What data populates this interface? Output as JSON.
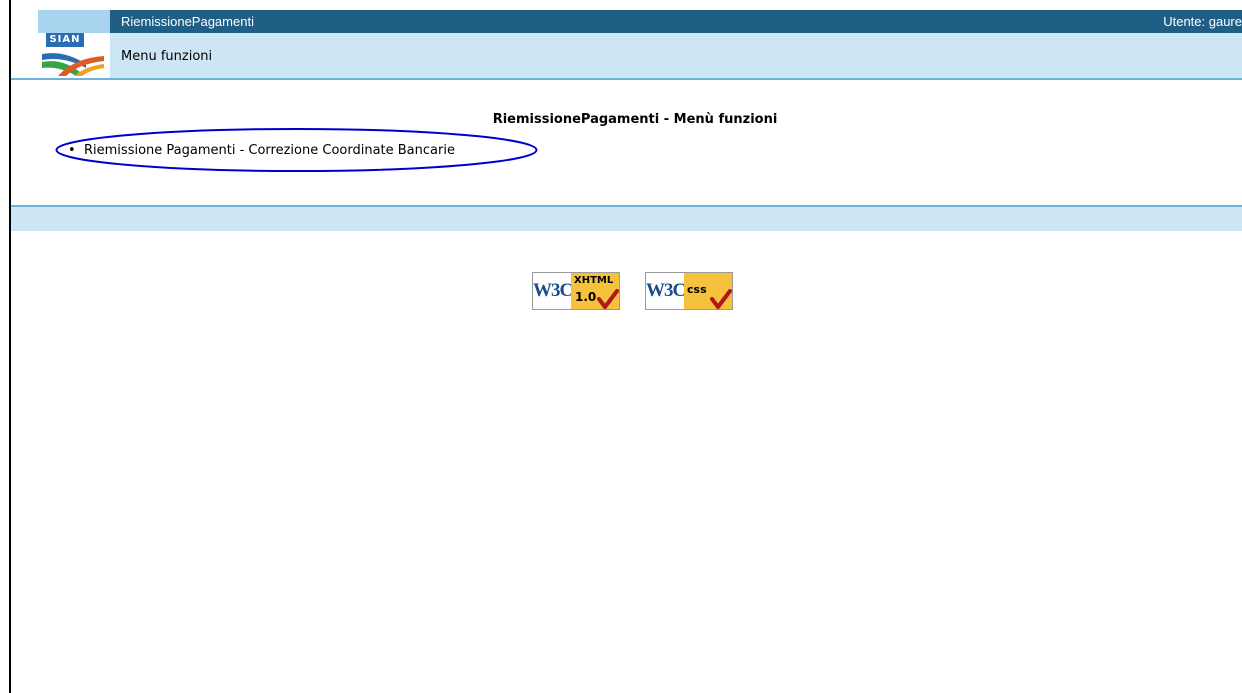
{
  "header": {
    "logo_text": "SIAN",
    "app_title": "RiemissionePagamenti",
    "user_label": "Utente: gaure"
  },
  "menu_bar": {
    "label": "Menu funzioni"
  },
  "main": {
    "heading": "RiemissionePagamenti - Menù funzioni",
    "items": [
      {
        "label": "Riemissione Pagamenti - Correzione Coordinate Bancarie"
      }
    ]
  },
  "badges": {
    "xhtml": {
      "brand": "W3C",
      "label_top": "XHTML",
      "label_bottom": "1.0",
      "icon": "check-icon"
    },
    "css": {
      "brand": "W3C",
      "label": "css",
      "icon": "check-icon"
    }
  },
  "colors": {
    "title_bar": "#1f5f85",
    "menu_bar": "#cde6f5",
    "highlight_oval": "#0000cc",
    "badge_gold": "#f6c23e",
    "check": "#b01818"
  }
}
